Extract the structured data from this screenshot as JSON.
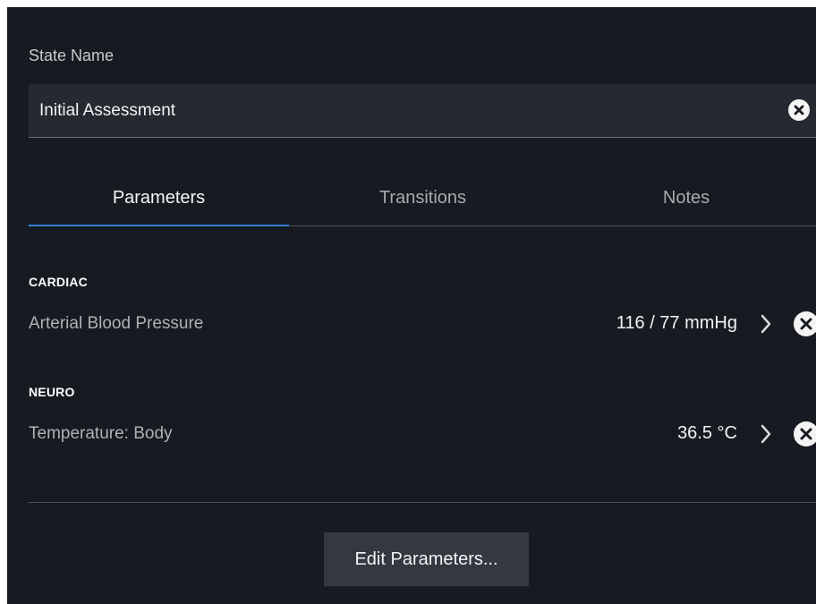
{
  "state": {
    "label": "State Name",
    "value": "Initial Assessment",
    "clear_icon": "close-circle-icon"
  },
  "tabs": [
    {
      "label": "Parameters",
      "selected": true
    },
    {
      "label": "Transitions",
      "selected": false
    },
    {
      "label": "Notes",
      "selected": false
    }
  ],
  "sections": [
    {
      "heading": "CARDIAC",
      "items": [
        {
          "name": "Arterial Blood Pressure",
          "value": "116 / 77 mmHg",
          "open_icon": "chevron-right-icon",
          "remove_icon": "close-circle-icon"
        }
      ]
    },
    {
      "heading": "NEURO",
      "items": [
        {
          "name": "Temperature: Body",
          "value": "36.5 °C",
          "open_icon": "chevron-right-icon",
          "remove_icon": "close-circle-icon"
        }
      ]
    }
  ],
  "actions": {
    "edit_parameters": "Edit Parameters..."
  },
  "colors": {
    "panel_background": "#171b21",
    "field_background": "#252a31",
    "active_tab_indicator": "#2f7fd2",
    "button_background": "#343941"
  }
}
